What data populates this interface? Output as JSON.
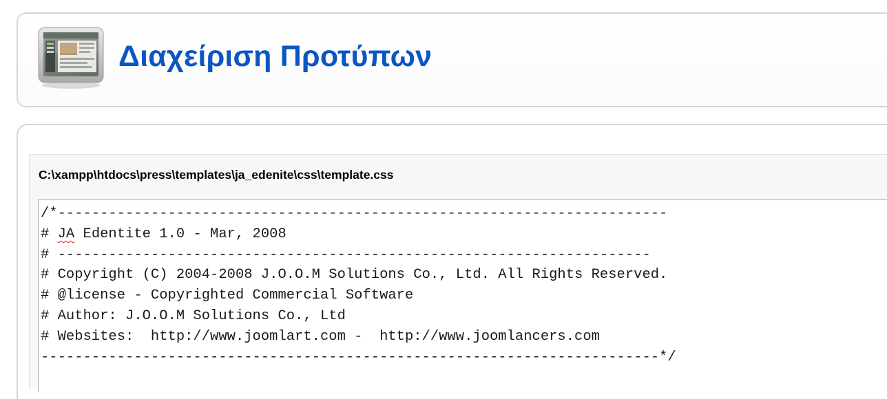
{
  "header": {
    "title": "Διαχείριση Προτύπων",
    "icon": "template-manager-icon",
    "title_color": "#0b55c4"
  },
  "file": {
    "path": "C:\\xampp\\htdocs\\press\\templates\\ja_edenite\\css\\template.css"
  },
  "editor": {
    "lines": [
      "/*------------------------------------------------------------------------",
      "# JA Edentite 1.0 - Mar, 2008",
      "# ----------------------------------------------------------------------",
      "# Copyright (C) 2004-2008 J.O.O.M Solutions Co., Ltd. All Rights Reserved.",
      "# @license - Copyrighted Commercial Software",
      "# Author: J.O.O.M Solutions Co., Ltd",
      "# Websites:  http://www.joomlart.com -  http://www.joomlancers.com",
      "-------------------------------------------------------------------------*/"
    ],
    "spellcheck_marked_word": "JA"
  },
  "colors": {
    "panel_border": "#d6d6d6",
    "section_bg": "#f7f7f7",
    "editor_border": "#a5acb2"
  }
}
